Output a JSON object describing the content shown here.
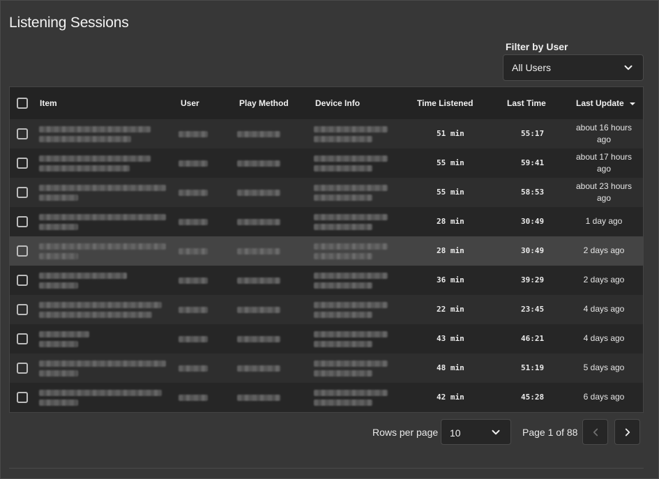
{
  "page": {
    "title": "Listening Sessions"
  },
  "filter": {
    "label": "Filter by User",
    "selected": "All Users"
  },
  "table": {
    "columns": {
      "item": "Item",
      "user": "User",
      "play_method": "Play Method",
      "device_info": "Device Info",
      "time_listened": "Time Listened",
      "last_time": "Last Time",
      "last_update": "Last Update"
    },
    "rows": [
      {
        "time_listened": "51 min",
        "last_time": "55:17",
        "last_update": "about 16 hours ago"
      },
      {
        "time_listened": "55 min",
        "last_time": "59:41",
        "last_update": "about 17 hours ago"
      },
      {
        "time_listened": "55 min",
        "last_time": "58:53",
        "last_update": "about 23 hours ago"
      },
      {
        "time_listened": "28 min",
        "last_time": "30:49",
        "last_update": "1 day ago"
      },
      {
        "time_listened": "28 min",
        "last_time": "30:49",
        "last_update": "2 days ago"
      },
      {
        "time_listened": "36 min",
        "last_time": "39:29",
        "last_update": "2 days ago"
      },
      {
        "time_listened": "22 min",
        "last_time": "23:45",
        "last_update": "4 days ago"
      },
      {
        "time_listened": "43 min",
        "last_time": "46:21",
        "last_update": "4 days ago"
      },
      {
        "time_listened": "48 min",
        "last_time": "51:19",
        "last_update": "5 days ago"
      },
      {
        "time_listened": "42 min",
        "last_time": "45:28",
        "last_update": "6 days ago"
      }
    ]
  },
  "pagination": {
    "rows_per_page_label": "Rows per page",
    "rows_per_page": "10",
    "page_info": "Page 1 of 88"
  },
  "icons": {
    "dropdown": "chevron-down-icon",
    "sort": "sort-desc-icon",
    "prev": "chevron-left-icon",
    "next": "chevron-right-icon"
  }
}
